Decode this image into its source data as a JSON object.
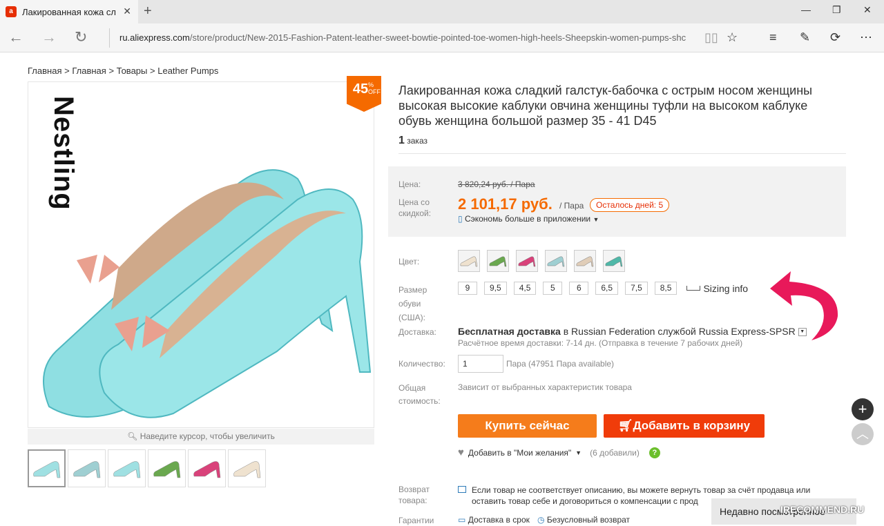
{
  "browser": {
    "tab_title": "Лакированная кожа сл",
    "url_domain": "ru.aliexpress.com",
    "url_path": "/store/product/New-2015-Fashion-Patent-leather-sweet-bowtie-pointed-toe-women-high-heels-Sheepskin-women-pumps-shc"
  },
  "breadcrumb": {
    "items": [
      "Главная",
      "Главная",
      "Товары",
      "Leather Pumps"
    ],
    "sep": ">"
  },
  "gallery": {
    "brand_text": "Nestling",
    "discount": "45",
    "percent": "%",
    "off": "OFF",
    "zoom_hint": "Наведите курсор, чтобы увеличить",
    "thumb_colors": [
      "#9fe0e2",
      "#9fcfd2",
      "#9fe0e2",
      "#6aa84f",
      "#d9427a",
      "#efe2cf"
    ]
  },
  "product": {
    "title": "Лакированная кожа сладкий галстук-бабочка с острым носом женщины высокая высокие каблуки овчина женщины туфли на высоком каблуке обувь женщина большой размер 35 - 41 D45",
    "orders_count": "1",
    "orders_label": "заказ"
  },
  "price": {
    "label": "Цена:",
    "old": "3 820,24 руб. / Пара",
    "discount_label": "Цена со скидкой:",
    "new": "2 101,17 руб.",
    "unit": "/ Пара",
    "days_left": "Осталось дней: 5",
    "app_save": "Сэкономь больше в приложении"
  },
  "options": {
    "color_label": "Цвет:",
    "colors": [
      "#efe2cf",
      "#6aa84f",
      "#d9427a",
      "#9fcfd2",
      "#e0cdb8",
      "#4fb8a8"
    ],
    "size_label": "Размер обуви (США):",
    "sizes": [
      "9",
      "9,5",
      "4,5",
      "5",
      "6",
      "6,5",
      "7,5",
      "8,5"
    ],
    "sizing_info": "Sizing info"
  },
  "shipping": {
    "label": "Доставка:",
    "free": "Бесплатная доставка",
    "in": "в",
    "dest": "Russian Federation службой Russia Express-SPSR",
    "eta": "Расчётное время доставки: 7-14 дн. (Отправка в течение 7 рабочих дней)"
  },
  "quantity": {
    "label": "Количество:",
    "value": "1",
    "available": "Пара (47951 Пара available)"
  },
  "total": {
    "label": "Общая стоимость:",
    "value": "Зависит от выбранных характеристик товара"
  },
  "actions": {
    "buy": "Купить сейчас",
    "cart": "Добавить в корзину",
    "wishlist": "Добавить в \"Мои желания\"",
    "wish_count": "(6 добавили)"
  },
  "returns": {
    "label": "Возврат товара:",
    "text": "Если товар не соответствует описанию, вы можете вернуть товар за счёт продавца или оставить товар себе и договориться о компенсации с прод"
  },
  "guarantee": {
    "label": "Гарантии",
    "item1": "Доставка в срок",
    "item2": "Безусловный возврат"
  },
  "recent": "Недавно посмотренное",
  "watermark": "IRECOMMEND.RU",
  "colors": {
    "accent": "#f56a00",
    "buy": "#f57c1b",
    "cart": "#f03c0a",
    "arrow": "#e8195a"
  }
}
